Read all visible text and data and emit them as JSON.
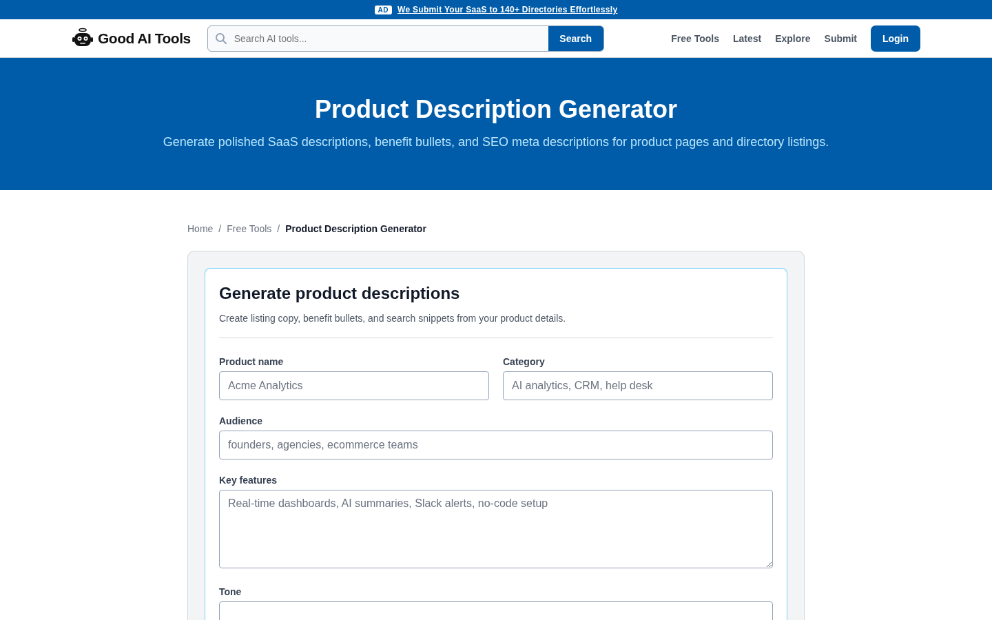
{
  "ad_bar": {
    "badge": "AD",
    "link": "We Submit Your SaaS to 140+ Directories Effortlessly"
  },
  "header": {
    "logo": "Good AI Tools",
    "search": {
      "placeholder": "Search AI tools...",
      "button": "Search"
    },
    "nav": [
      "Free Tools",
      "Latest",
      "Explore",
      "Submit"
    ],
    "login": "Login"
  },
  "hero": {
    "title": "Product Description Generator",
    "subtitle": "Generate polished SaaS descriptions, benefit bullets, and SEO meta descriptions for product pages and directory listings."
  },
  "breadcrumb_separator": "/",
  "breadcrumb": [
    {
      "label": "Home",
      "selected": false
    },
    {
      "label": "Free Tools",
      "selected": false
    },
    {
      "label": "Product Description Generator",
      "selected": true
    }
  ],
  "form": {
    "title": "Generate product descriptions",
    "subtitle": "Create listing copy, benefit bullets, and search snippets from your product details.",
    "fields": [
      {
        "kind": "input",
        "label": "Product name",
        "placeholder": "Acme Analytics"
      },
      {
        "kind": "input",
        "label": "Category",
        "placeholder": "AI analytics, CRM, help desk"
      },
      {
        "kind": "input",
        "label": "Audience",
        "placeholder": "founders, agencies, ecommerce teams"
      },
      {
        "kind": "textarea",
        "label": "Key features",
        "placeholder": "Real-time dashboards, AI summaries, Slack alerts, no-code setup"
      },
      {
        "kind": "select",
        "label": "Tone"
      }
    ]
  }
}
